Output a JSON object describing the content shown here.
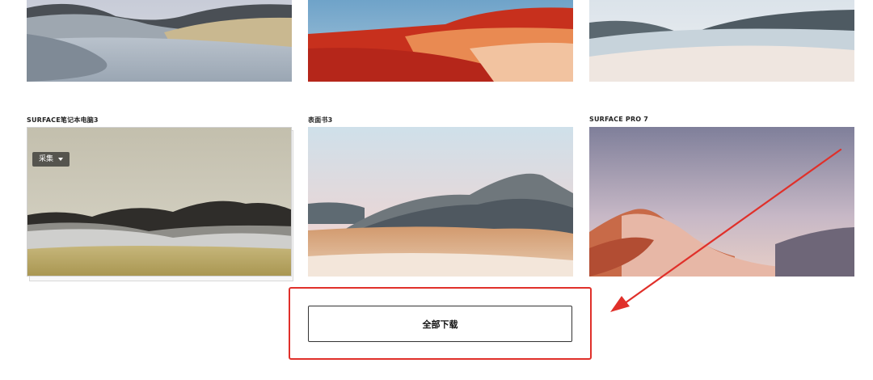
{
  "gallery": {
    "top_row": [
      {
        "caption": ""
      },
      {
        "caption": ""
      },
      {
        "caption": ""
      }
    ],
    "bottom_row": [
      {
        "caption": "SURFACE笔记本电脑3"
      },
      {
        "caption": "表面书3"
      },
      {
        "caption": "SURFACE PRO 7"
      }
    ],
    "collect_label": "采集"
  },
  "actions": {
    "download_all_label": "全部下载"
  },
  "colors": {
    "highlight_border": "#e0302a",
    "arrow": "#e0302a"
  }
}
